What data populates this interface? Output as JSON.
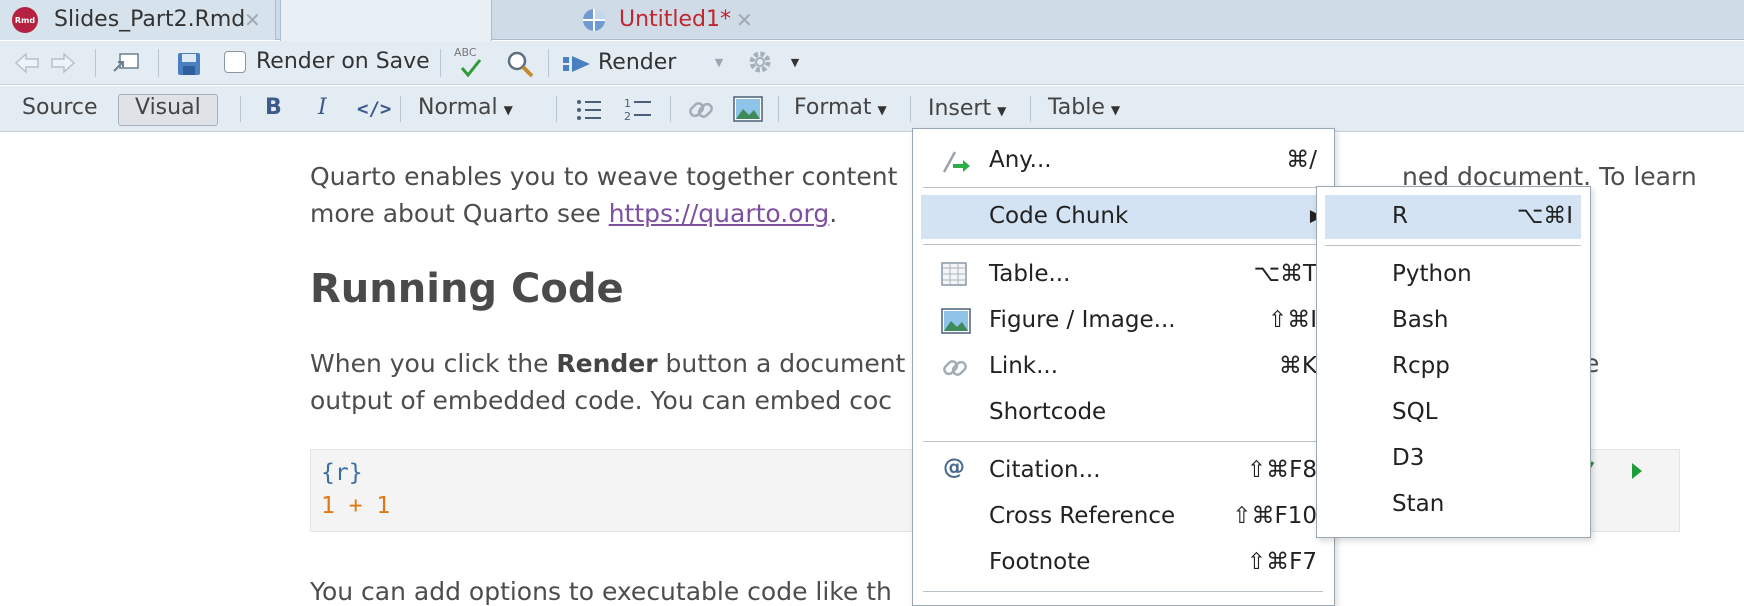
{
  "tabs": [
    {
      "label": "Slides_Part2.Rmd",
      "badge": "Rmd"
    },
    {
      "label": "Untitled1*"
    }
  ],
  "toolbar": {
    "render_on_save_label": "Render on Save",
    "abc_label": "ABC",
    "render_label": "Render"
  },
  "visual_bar": {
    "source_label": "Source",
    "visual_label": "Visual",
    "bold_label": "B",
    "italic_label": "I",
    "code_label": "</>",
    "style_label": "Normal",
    "format_label": "Format",
    "insert_label": "Insert",
    "table_label": "Table"
  },
  "document": {
    "para1_a": "Quarto enables you to weave together content",
    "para1_b": "ned document. To learn",
    "para1_c": "more about Quarto see ",
    "link": "https://quarto.org",
    "para1_d": ".",
    "heading": "Running Code",
    "para2_a": "When you click the ",
    "para2_bold": "Render",
    "para2_b": " button a document",
    "para2_c": "e",
    "para2_d": "output of embedded code. You can embed coc",
    "code_header": "{r}",
    "code_line": "1 + 1",
    "para3": "You can add options to executable code like th"
  },
  "insert_menu": {
    "items": [
      {
        "label": "Any...",
        "shortcut": "⌘/"
      },
      {
        "label": "Code Chunk",
        "shortcut": "▶"
      },
      {
        "label": "Table...",
        "shortcut": "⌥⌘T"
      },
      {
        "label": "Figure / Image...",
        "shortcut": "⇧⌘I"
      },
      {
        "label": "Link...",
        "shortcut": "⌘K"
      },
      {
        "label": "Shortcode",
        "shortcut": ""
      },
      {
        "label": "Citation...",
        "shortcut": "⇧⌘F8"
      },
      {
        "label": "Cross Reference",
        "shortcut": "⇧⌘F10"
      },
      {
        "label": "Footnote",
        "shortcut": "⇧⌘F7"
      }
    ],
    "citation_icon": "@"
  },
  "code_chunk_submenu": {
    "items": [
      {
        "label": "R",
        "shortcut": "⌥⌘I"
      },
      {
        "label": "Python",
        "shortcut": ""
      },
      {
        "label": "Bash",
        "shortcut": ""
      },
      {
        "label": "Rcpp",
        "shortcut": ""
      },
      {
        "label": "SQL",
        "shortcut": ""
      },
      {
        "label": "D3",
        "shortcut": ""
      },
      {
        "label": "Stan",
        "shortcut": ""
      }
    ]
  },
  "colors": {
    "highlight": "#d3e3f3",
    "link": "#7d50a0",
    "code_orange": "#e07a10",
    "code_blue": "#3a6ea5",
    "run_green": "#1e9e3a"
  }
}
